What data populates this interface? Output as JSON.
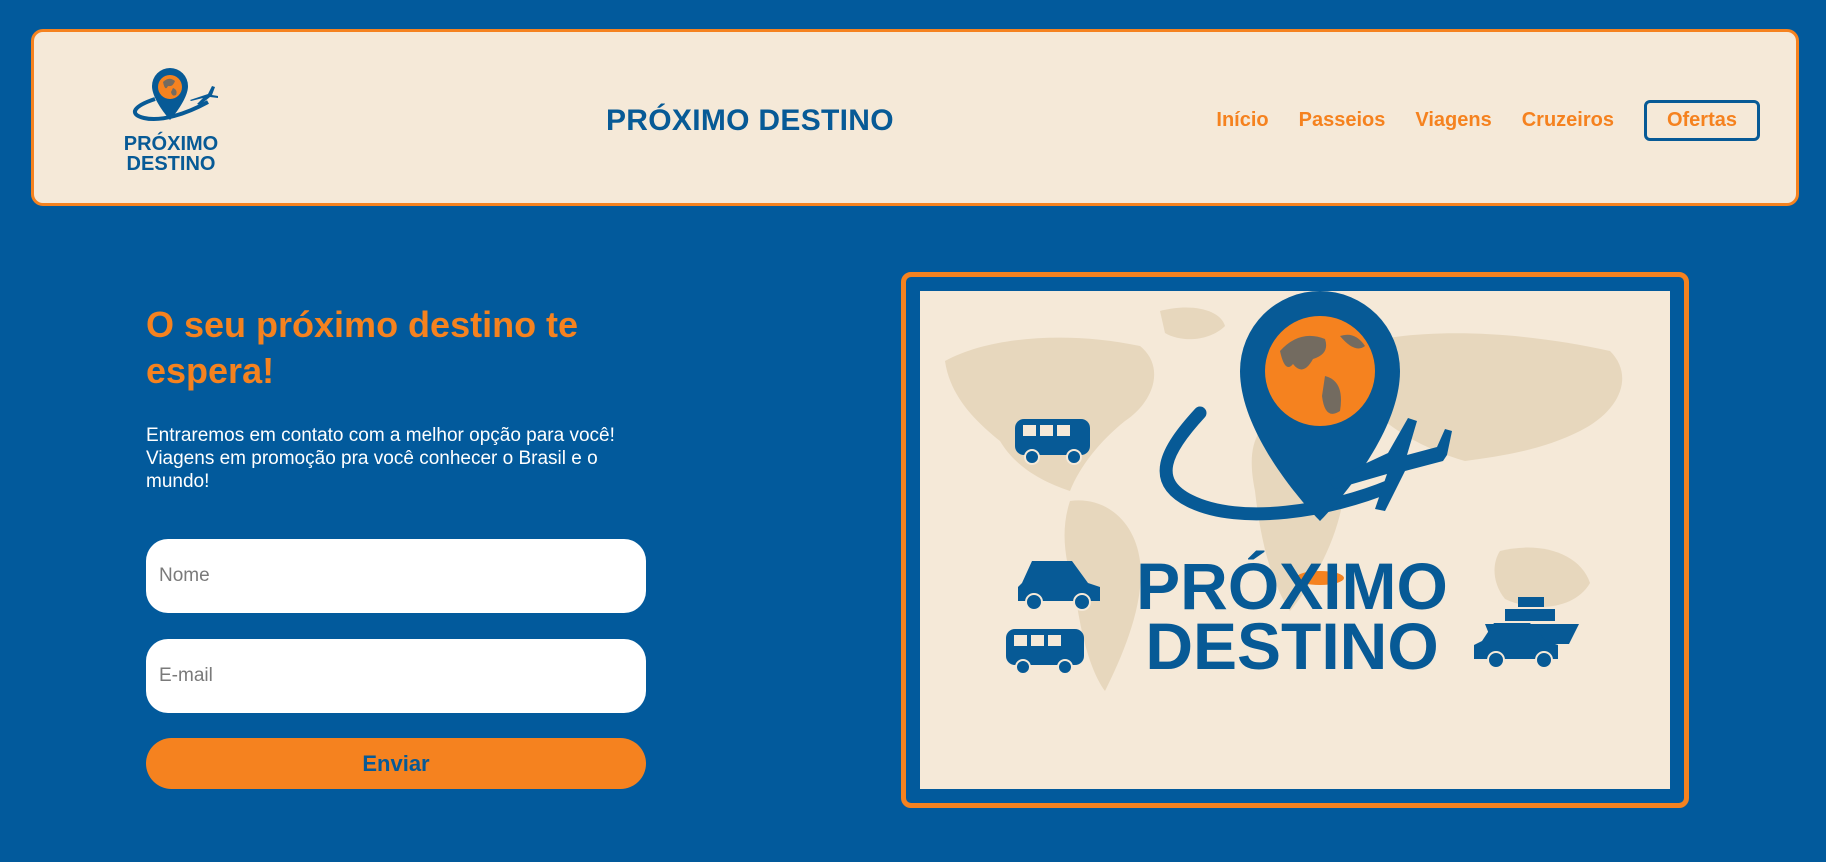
{
  "brand": {
    "logo_line1": "PRÓXIMO",
    "logo_line2": "DESTINO",
    "title": "PRÓXIMO DESTINO"
  },
  "nav": {
    "items": [
      "Início",
      "Passeios",
      "Viagens",
      "Cruzeiros"
    ],
    "offers": "Ofertas"
  },
  "hero": {
    "title": "O seu próximo destino te espera!",
    "text": "Entraremos em contato com a melhor opção para você! Viagens em promoção pra você conhecer o Brasil e o mundo!"
  },
  "form": {
    "name_placeholder": "Nome",
    "email_placeholder": "E-mail",
    "submit_label": "Enviar"
  },
  "colors": {
    "background": "#025a9c",
    "accent": "#f5821f",
    "cream": "#f5e9d8",
    "navy": "#075a96"
  }
}
